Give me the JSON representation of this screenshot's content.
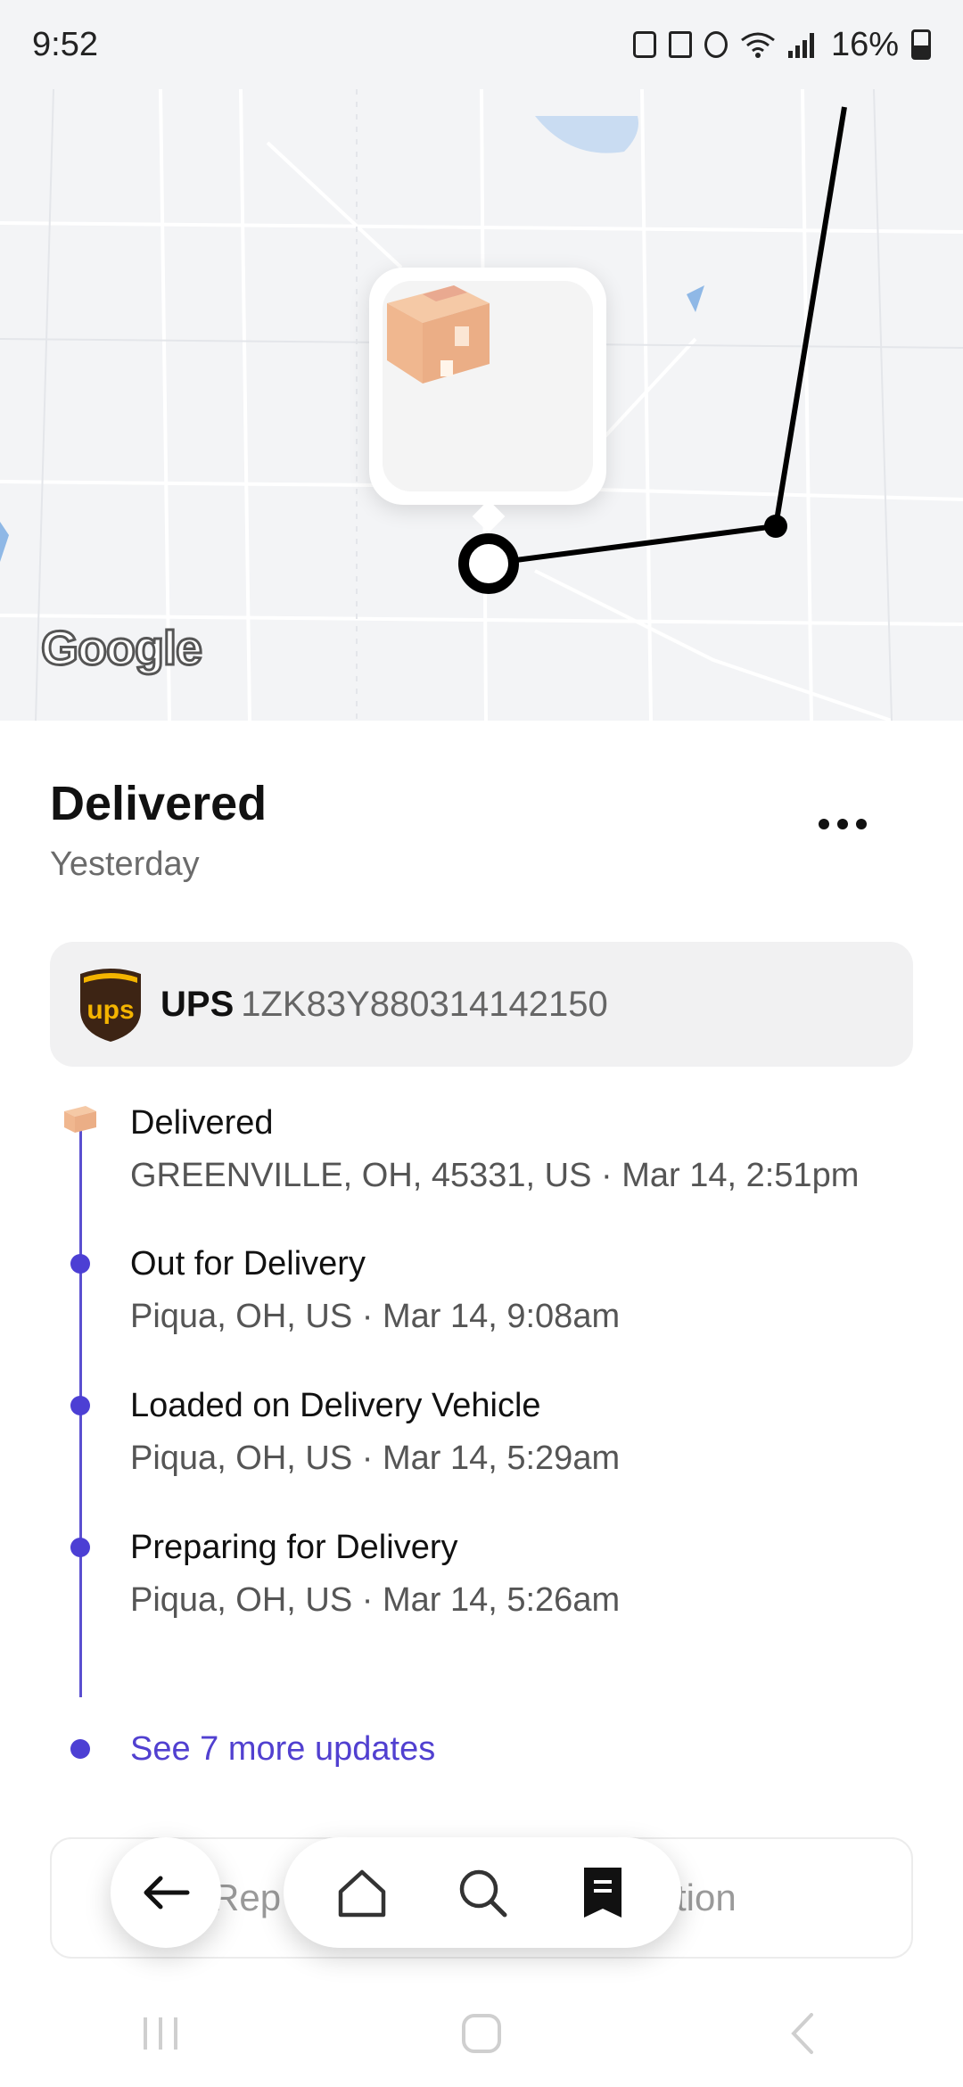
{
  "status_bar": {
    "time": "9:52",
    "battery": "16%",
    "icons": [
      "sim-icon",
      "nfc-icon",
      "alarm-icon",
      "wifi-icon",
      "signal-icon",
      "battery-icon"
    ]
  },
  "map": {
    "attribution": "Google"
  },
  "shipment": {
    "status": "Delivered",
    "when": "Yesterday",
    "carrier": "UPS",
    "tracking_number": "1ZK83Y880314142150",
    "carrier_logo_text": "ups"
  },
  "events": [
    {
      "title": "Delivered",
      "detail": "GREENVILLE, OH, 45331, US · Mar 14, 2:51pm"
    },
    {
      "title": "Out for Delivery",
      "detail": "Piqua, OH, US · Mar 14, 9:08am"
    },
    {
      "title": "Loaded on Delivery Vehicle",
      "detail": "Piqua, OH, US · Mar 14, 5:29am"
    },
    {
      "title": "Preparing for Delivery",
      "detail": "Piqua, OH, US · Mar 14, 5:26am"
    }
  ],
  "see_more": "See 7 more updates",
  "report_button": {
    "left_text": "Rep",
    "right_text": "tion"
  },
  "bottom_nav": {
    "back": "arrow-left-icon",
    "items": [
      "home-icon",
      "search-icon",
      "receipt-icon"
    ]
  },
  "colors": {
    "accent": "#4c3fd4",
    "link": "#5140d0",
    "ups_brown": "#3d2414",
    "ups_gold": "#f4b400"
  }
}
